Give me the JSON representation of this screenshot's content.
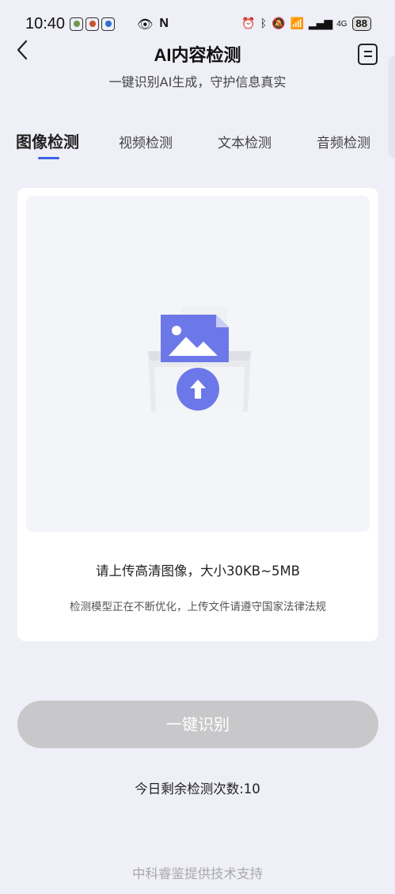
{
  "status_bar": {
    "time": "10:40",
    "battery": "88",
    "network": "4G"
  },
  "header": {
    "title": "AI内容检测",
    "subtitle": "一键识别AI生成，守护信息真实"
  },
  "tabs": [
    {
      "label": "图像检测",
      "active": true
    },
    {
      "label": "视频检测",
      "active": false
    },
    {
      "label": "文本检测",
      "active": false
    },
    {
      "label": "音频检测",
      "active": false
    }
  ],
  "upload": {
    "hint": "请上传高清图像，大小30KB~5MB",
    "note": "检测模型正在不断优化，上传文件请遵守国家法律法规"
  },
  "detect_button": {
    "label": "一键识别"
  },
  "remaining": "今日剩余检测次数:10",
  "footer": "中科睿鉴提供技术支持",
  "colors": {
    "accent": "#3f63e0",
    "illustration": "#6d78e8",
    "button_disabled": "#c8c8ca",
    "background": "#eeeff7"
  }
}
